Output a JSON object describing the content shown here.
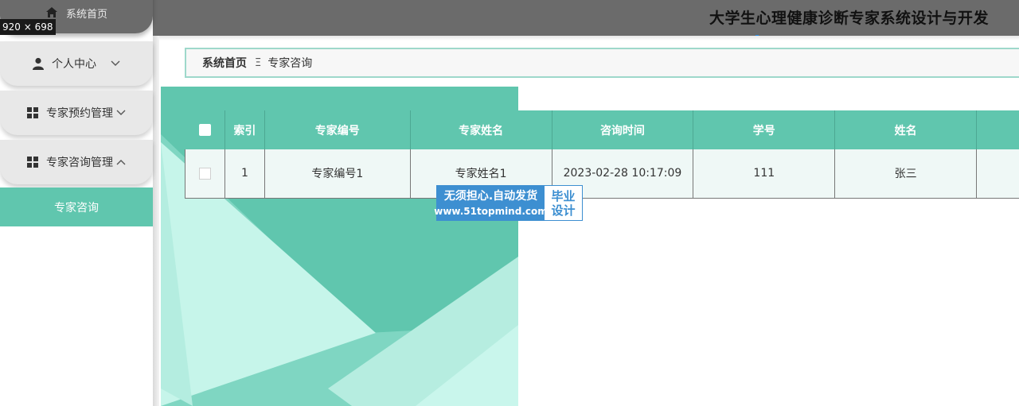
{
  "window": {
    "size_badge": "920 × 698"
  },
  "header": {
    "title": "大学生心理健康诊断专家系统设计与开发"
  },
  "sidebar": {
    "items": [
      {
        "label": "系统首页",
        "icon": "home-icon"
      },
      {
        "label": "个人中心",
        "icon": "user-icon",
        "chevron": "chevron-down-icon"
      },
      {
        "label": "专家预约管理",
        "icon": "grid-icon",
        "chevron": "chevron-down-icon"
      },
      {
        "label": "专家咨询管理",
        "icon": "grid-icon",
        "chevron": "chevron-up-icon"
      }
    ],
    "active_submenu": "专家咨询"
  },
  "breadcrumb": {
    "home": "系统首页",
    "separator": "Ξ",
    "current": "专家咨询"
  },
  "table": {
    "headers": [
      "索引",
      "专家编号",
      "专家姓名",
      "咨询时间",
      "学号",
      "姓名"
    ],
    "rows": [
      {
        "index": "1",
        "expert_id": "专家编号1",
        "expert_name": "专家姓名1",
        "time": "2023-02-28 10:17:09",
        "student_id": "111",
        "name": "张三"
      }
    ]
  },
  "watermark": {
    "line1": "无须担心.自动发货",
    "line2": "www.51topmind.com",
    "right1": "毕业",
    "right2": "设计"
  },
  "colors": {
    "accent": "#60c6ae",
    "header_bar": "#6b6b6b",
    "watermark_blue": "#3d8fd1"
  }
}
